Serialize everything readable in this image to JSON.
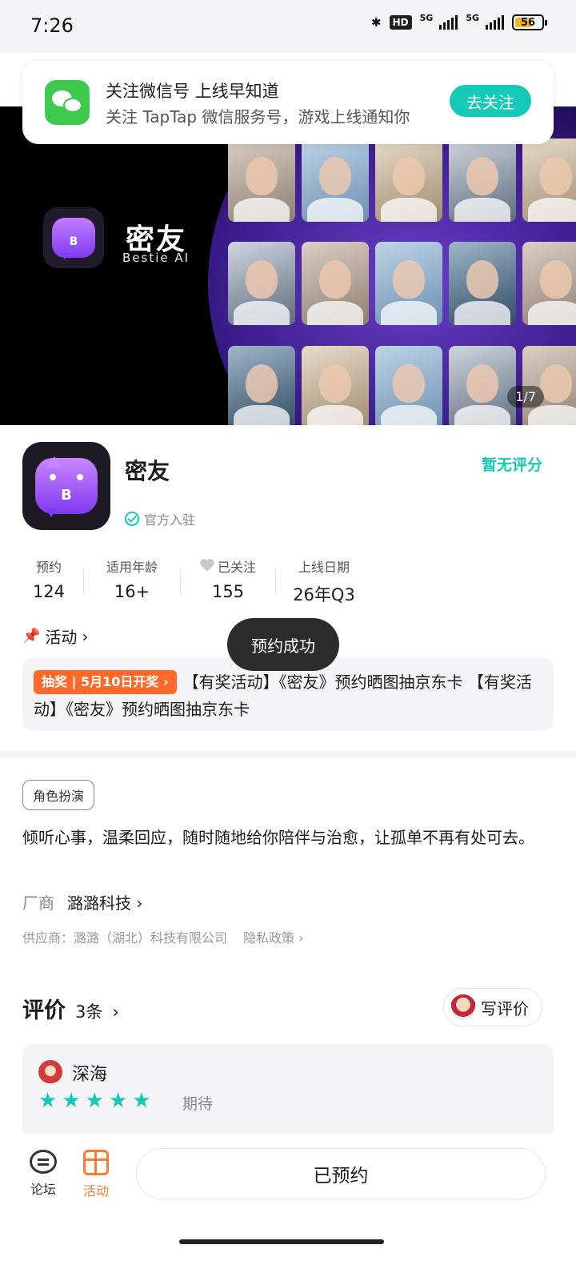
{
  "status_bar": {
    "time": "7:26",
    "hd": "HD",
    "net1": "5G",
    "net2": "5G",
    "battery": "56"
  },
  "notification": {
    "title": "关注微信号 上线早知道",
    "subtitle": "关注 TapTap 微信服务号，游戏上线通知你",
    "button": "去关注"
  },
  "hero": {
    "title": "密友",
    "subtitle": "Bestie AI",
    "counter": "1/7"
  },
  "app": {
    "name": "密友",
    "official_label": "官方入驻",
    "rating": "暂无评分"
  },
  "stats": [
    {
      "label": "预约",
      "value": "124"
    },
    {
      "label": "适用年龄",
      "value": "16+"
    },
    {
      "label": "已关注",
      "value": "155"
    },
    {
      "label": "上线日期",
      "value": "26年Q3"
    }
  ],
  "activity": {
    "heading": "活动",
    "badge": "抽奖 | 5月10日开奖 ›",
    "text": "【有奖活动】《密友》预约晒图抽京东卡 【有奖活动】《密友》预约晒图抽京东卡"
  },
  "toast": "预约成功",
  "details": {
    "tag": "角色扮演",
    "description": "倾听心事，温柔回应，随时随地给你陪伴与治愈，让孤单不再有处可去。",
    "vendor_label": "厂商",
    "vendor_name": "潞潞科技 ›",
    "provider": "供应商：潞潞（湖北）科技有限公司",
    "privacy": "隐私政策 ›"
  },
  "reviews": {
    "title": "评价",
    "count": "3条",
    "write_button": "写评价",
    "items": [
      {
        "name": "深海",
        "rating": 5,
        "tag": "期待"
      }
    ]
  },
  "bottom_nav": {
    "forum": "论坛",
    "activity": "活动",
    "reserved_button": "已预约"
  },
  "colors": {
    "accent": "#15c9b9",
    "orange": "#ff6a2a",
    "wechat": "#3dc94b"
  }
}
